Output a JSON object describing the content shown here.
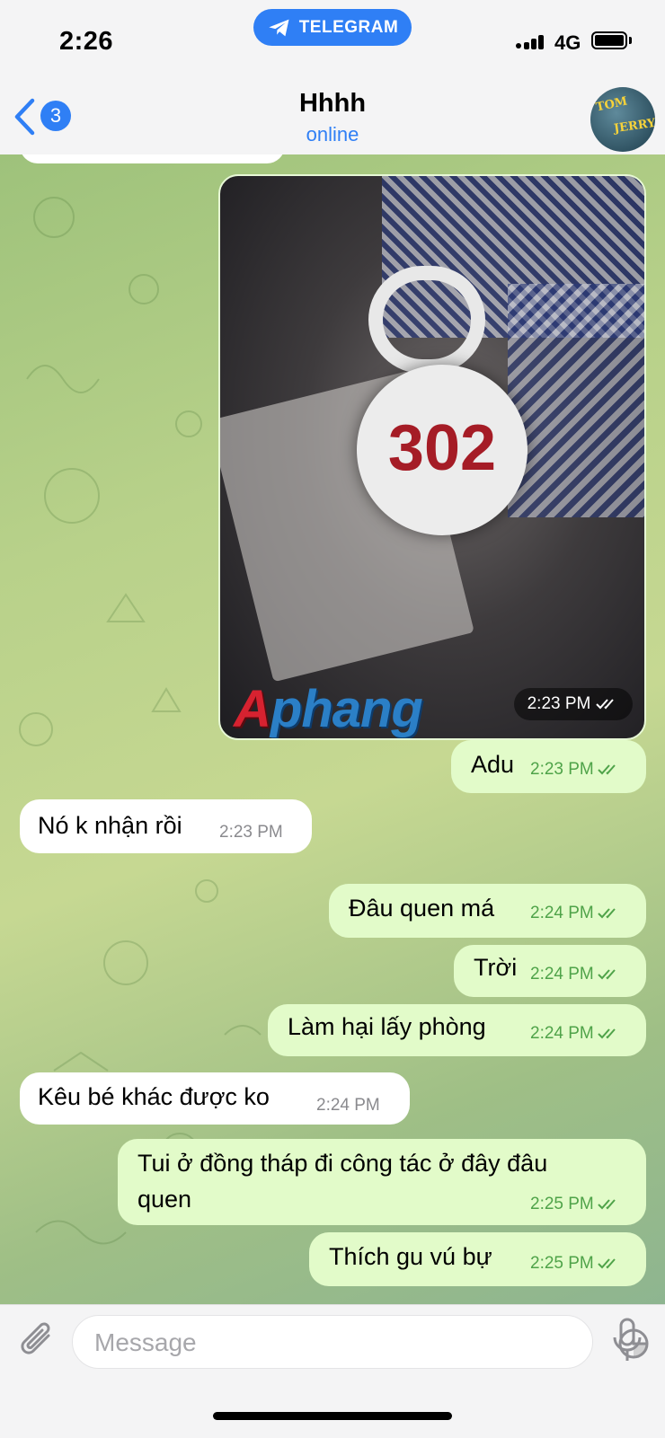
{
  "status_bar": {
    "time": "2:26",
    "app_pill": "TELEGRAM",
    "network": "4G",
    "icons": [
      "signal-icon",
      "battery-icon"
    ]
  },
  "header": {
    "back_badge": "3",
    "title": "Hhhh",
    "subtitle": "online",
    "avatar_text": [
      "TOM",
      "JERRY"
    ]
  },
  "photo_message": {
    "keytag_number": "302",
    "watermark": "Aphang",
    "watermark_first": "A",
    "watermark_rest": "phang",
    "time": "2:23 PM"
  },
  "messages": [
    {
      "direction": "out",
      "text": "Adu",
      "time": "2:23 PM"
    },
    {
      "direction": "in",
      "text": "Nó k nhận rồi",
      "time": "2:23 PM"
    },
    {
      "direction": "out",
      "text": "Đâu quen má",
      "time": "2:24 PM"
    },
    {
      "direction": "out",
      "text": "Trời",
      "time": "2:24 PM"
    },
    {
      "direction": "out",
      "text": "Làm hại lấy phòng",
      "time": "2:24 PM"
    },
    {
      "direction": "in",
      "text": "Kêu bé khác được ko",
      "time": "2:24 PM"
    },
    {
      "direction": "out",
      "text_line1": "Tui ở đồng tháp đi công tác ở đây đâu",
      "text_line2": "quen",
      "time": "2:25 PM"
    },
    {
      "direction": "out",
      "text": "Thích gu vú bự",
      "time": "2:25 PM"
    }
  ],
  "composer": {
    "placeholder": "Message"
  },
  "colors": {
    "accent": "#2f7ff5",
    "outgoing_bubble": "#e2fbc9",
    "outgoing_meta": "#4fa349",
    "incoming_bubble": "#ffffff"
  }
}
